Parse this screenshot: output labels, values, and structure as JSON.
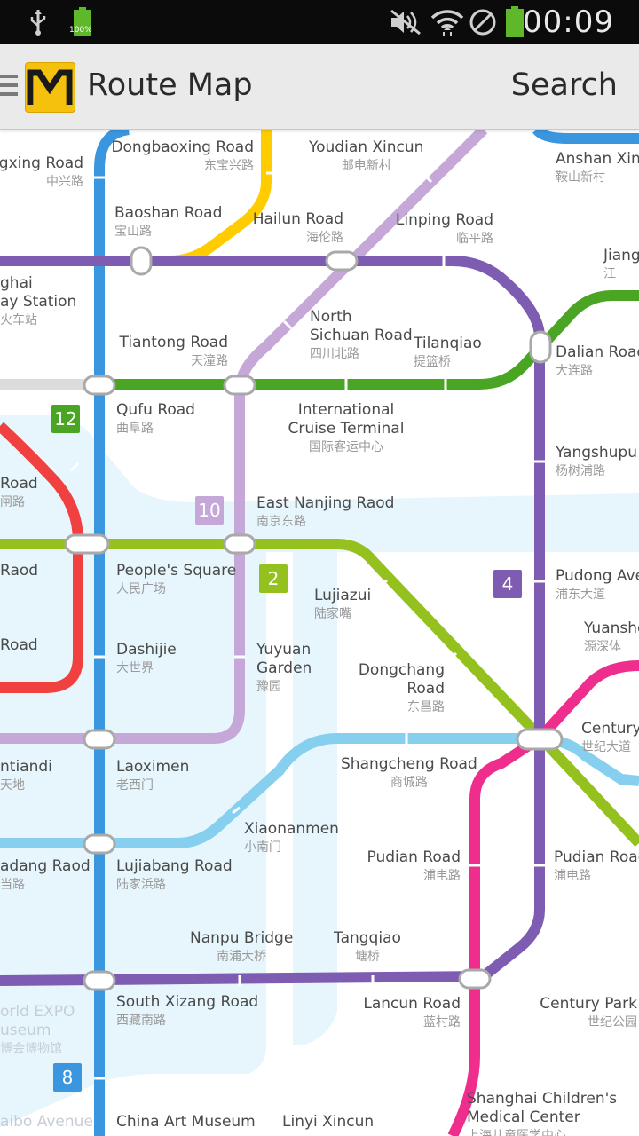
{
  "status_bar": {
    "battery_text": "100%",
    "time": "00:09",
    "icons": [
      "usb-icon",
      "battery-icon",
      "mute-icon",
      "wifi-icon",
      "blocked-icon",
      "battery-icon"
    ]
  },
  "app_bar": {
    "title": "Route Map",
    "search_label": "Search",
    "logo_letter": "M"
  },
  "lines": {
    "line2": {
      "number": "2",
      "color": "#95c11f"
    },
    "line4": {
      "number": "4",
      "color": "#7d5cb1"
    },
    "line8": {
      "number": "8",
      "color": "#3a97df"
    },
    "line10": {
      "number": "10",
      "color": "#c5a8d8"
    },
    "line12": {
      "number": "12",
      "color": "#4aa524"
    },
    "line3": {
      "color": "#ffcc00"
    },
    "line6": {
      "color": "#ef2d8c"
    },
    "line9": {
      "color": "#87cfef"
    },
    "line13": {
      "color": "#f04040"
    },
    "river_color": "#e6f6fc"
  },
  "stations": [
    {
      "id": "zhongxing",
      "en": "ngxing Road",
      "cn": "中兴路"
    },
    {
      "id": "dongbaoxing",
      "en": "Dongbaoxing Road",
      "cn": "东宝兴路"
    },
    {
      "id": "youdian",
      "en": "Youdian Xincun",
      "cn": "邮电新村"
    },
    {
      "id": "anshan",
      "en": "Anshan Xinc",
      "cn": "鞍山新村"
    },
    {
      "id": "baoshan",
      "en": "Baoshan Road",
      "cn": "宝山路"
    },
    {
      "id": "hailun",
      "en": "Hailun Road",
      "cn": "海伦路"
    },
    {
      "id": "linping",
      "en": "Linping Road",
      "cn": "临平路"
    },
    {
      "id": "jiang",
      "en": "Jiang",
      "cn": "江"
    },
    {
      "id": "shanghai_rw",
      "en": "ghai\nay Station",
      "cn": "火车站"
    },
    {
      "id": "north_sichuan",
      "en": "North\nSichuan Road",
      "cn": "四川北路"
    },
    {
      "id": "tiantong",
      "en": "Tiantong Road",
      "cn": "天潼路"
    },
    {
      "id": "tilanqiao",
      "en": "Tilanqiao",
      "cn": "提篮桥"
    },
    {
      "id": "dalian",
      "en": "Dalian Road",
      "cn": "大连路"
    },
    {
      "id": "qufu",
      "en": "Qufu Road",
      "cn": "曲阜路"
    },
    {
      "id": "cruise",
      "en": "International\nCruise Terminal",
      "cn": "国际客运中心"
    },
    {
      "id": "yangshupu",
      "en": "Yangshupu",
      "cn": "杨树浦路"
    },
    {
      "id": "road_left1",
      "en": "Road",
      "cn": "闸路"
    },
    {
      "id": "east_nanjing",
      "en": "East Nanjing Raod",
      "cn": "南京东路"
    },
    {
      "id": "raod_left",
      "en": "Raod",
      "cn": ""
    },
    {
      "id": "peoples_square",
      "en": "People's Square",
      "cn": "人民广场"
    },
    {
      "id": "lujiazui",
      "en": "Lujiazui",
      "cn": "陆家嘴"
    },
    {
      "id": "pudong_ave",
      "en": "Pudong Ave",
      "cn": "浦东大道"
    },
    {
      "id": "yuanshen",
      "en": "Yuanshe",
      "cn": "源深体"
    },
    {
      "id": "road_left2",
      "en": "Road",
      "cn": ""
    },
    {
      "id": "dashijie",
      "en": "Dashijie",
      "cn": "大世界"
    },
    {
      "id": "yuyuan",
      "en": "Yuyuan\nGarden",
      "cn": "豫园"
    },
    {
      "id": "dongchang",
      "en": "Dongchang\nRoad",
      "cn": "东昌路"
    },
    {
      "id": "century_ave",
      "en": "Century",
      "cn": "世纪大道"
    },
    {
      "id": "xintiandi",
      "en": "ntiandi",
      "cn": "天地"
    },
    {
      "id": "laoximen",
      "en": "Laoximen",
      "cn": "老西门"
    },
    {
      "id": "shangcheng",
      "en": "Shangcheng Road",
      "cn": "商城路"
    },
    {
      "id": "xiaonanmen",
      "en": "Xiaonanmen",
      "cn": "小南门"
    },
    {
      "id": "madang",
      "en": "adang Raod",
      "cn": "当路"
    },
    {
      "id": "lujiabang",
      "en": "Lujiabang Road",
      "cn": "陆家浜路"
    },
    {
      "id": "pudian_w",
      "en": "Pudian Road",
      "cn": "浦电路"
    },
    {
      "id": "pudian_e",
      "en": "Pudian Road",
      "cn": "浦电路"
    },
    {
      "id": "nanpu",
      "en": "Nanpu Bridge",
      "cn": "南浦大桥"
    },
    {
      "id": "tangqiao",
      "en": "Tangqiao",
      "cn": "塘桥"
    },
    {
      "id": "expo",
      "en": "orld EXPO\nuseum",
      "cn": "博会博物馆"
    },
    {
      "id": "south_xizang",
      "en": "South Xizang Road",
      "cn": "西藏南路"
    },
    {
      "id": "lancun",
      "en": "Lancun Road",
      "cn": "蓝村路"
    },
    {
      "id": "century_park",
      "en": "Century Park",
      "cn": "世纪公园"
    },
    {
      "id": "china_art",
      "en": "China Art Museum",
      "cn": ""
    },
    {
      "id": "linyi",
      "en": "Linyi Xincun",
      "cn": ""
    },
    {
      "id": "children",
      "en": "Shanghai Children's\nMedical Center",
      "cn": "上海儿童医学中心"
    },
    {
      "id": "zhaibo",
      "en": "aibo Avenue",
      "cn": ""
    }
  ]
}
